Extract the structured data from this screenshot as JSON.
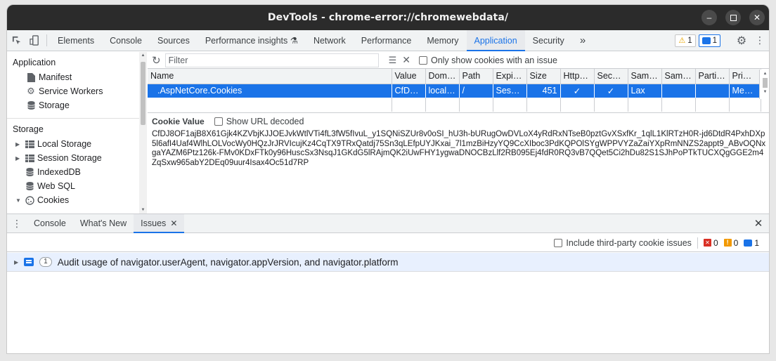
{
  "window": {
    "title": "DevTools - chrome-error://chromewebdata/"
  },
  "main_tabs": [
    {
      "label": "Elements"
    },
    {
      "label": "Console"
    },
    {
      "label": "Sources"
    },
    {
      "label": "Performance insights ⚗"
    },
    {
      "label": "Network"
    },
    {
      "label": "Performance"
    },
    {
      "label": "Memory"
    },
    {
      "label": "Application",
      "active": true
    },
    {
      "label": "Security"
    }
  ],
  "overflow_label": "»",
  "badges": {
    "warnings": "1",
    "info": "1"
  },
  "sidebar": {
    "application_header": "Application",
    "application_items": [
      {
        "label": "Manifest",
        "icon": "file-icon"
      },
      {
        "label": "Service Workers",
        "icon": "gear-icon"
      },
      {
        "label": "Storage",
        "icon": "database-icon"
      }
    ],
    "storage_header": "Storage",
    "storage_items": [
      {
        "label": "Local Storage",
        "icon": "grid-icon",
        "expand": "collapsed"
      },
      {
        "label": "Session Storage",
        "icon": "grid-icon",
        "expand": "collapsed"
      },
      {
        "label": "IndexedDB",
        "icon": "database-icon",
        "expand": "none"
      },
      {
        "label": "Web SQL",
        "icon": "database-icon",
        "expand": "none"
      },
      {
        "label": "Cookies",
        "icon": "cookie-icon",
        "expand": "expanded"
      }
    ]
  },
  "cookies": {
    "filter_placeholder": "Filter",
    "only_issues_label": "Only show cookies with an issue",
    "columns": [
      "Name",
      "Value",
      "Dom…",
      "Path",
      "Expi…",
      "Size",
      "Http…",
      "Secure",
      "Sam…",
      "Sam…",
      "Parti…",
      "Pri…"
    ],
    "rows": [
      [
        "",
        ".AspNetCore.Cookies",
        "CfDJ…",
        "local…",
        "/",
        "Sess…",
        "451",
        "✓",
        "✓",
        "Lax",
        "",
        "",
        "Med…"
      ]
    ],
    "cookie_value_title": "Cookie Value",
    "show_url_decoded": "Show URL decoded",
    "cookie_value": "CfDJ8OF1ajB8X61Gjk4KZVbjKJJOEJvkWtlVTi4fL3fW5fIvuL_y1SQNiSZUr8v0oSI_hU3h-bURugOwDVLoX4yRdRxNTseB0pztGvXSxfKr_1qlL1KlRTzH0R-jd6DtdR4PxhDXp5l6afI4Uaf4WlhLOLVocWy0HQzJrJRVIcujKz4CqTX9TRxQatdj75Sn3qLEfpUYJKxai_7l1mzBiHzyYQ9CcXIboc3PdKQPOlSYgWPPVYZaZaiYXpRmNNZS2appt9_ABvOQNxgaYAZM6Ptz126k-FMv0KDxFTk0y96HuscSx3NsqJ1GKdG5lRAjmQK2iUwFHY1ygwaDNOCBzLlf2RB095Ej4fdR0RQ3vB7QQet5Ci2hDu82S1SJhPoPTkTUCXQgGGE2m4ZqSxw965abY2DEq09uur4Isax4Oc51d7RP"
  },
  "drawer": {
    "tabs": [
      {
        "label": "Console"
      },
      {
        "label": "What's New"
      },
      {
        "label": "Issues",
        "active": true,
        "closable": true
      }
    ],
    "third_party_label": "Include third-party cookie issues",
    "counts": {
      "errors": "0",
      "warnings": "0",
      "info": "1"
    },
    "issue": {
      "count": "1",
      "title": "Audit usage of navigator.userAgent, navigator.appVersion, and navigator.platform"
    }
  },
  "colors": {
    "accent": "#1a73e8",
    "title_bar": "#2b2b2b",
    "selected_row": "#1a73e8",
    "issue_row": "#e8f0fe"
  }
}
